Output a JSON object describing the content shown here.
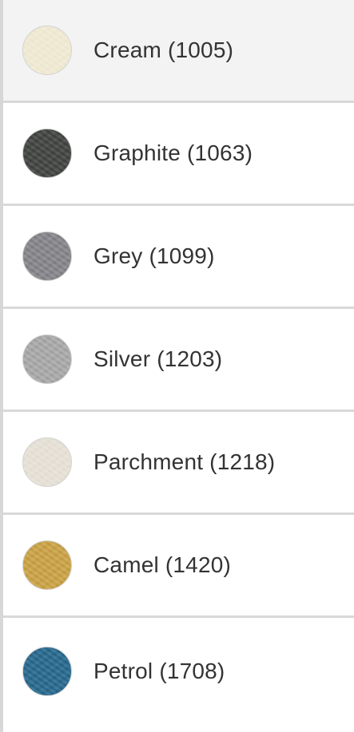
{
  "colors": {
    "item_1": "#efe9d3",
    "item_2": "#474947",
    "item_3": "#87878c",
    "item_4": "#a9a9a9",
    "item_5": "#e6e0d6",
    "item_6": "#c9a34a",
    "item_7": "#2e6c8f"
  },
  "items": [
    {
      "label": "Cream (1005)",
      "selected": true
    },
    {
      "label": "Graphite (1063)",
      "selected": false
    },
    {
      "label": "Grey (1099)",
      "selected": false
    },
    {
      "label": "Silver (1203)",
      "selected": false
    },
    {
      "label": "Parchment (1218)",
      "selected": false
    },
    {
      "label": "Camel (1420)",
      "selected": false
    },
    {
      "label": "Petrol (1708)",
      "selected": false
    }
  ]
}
